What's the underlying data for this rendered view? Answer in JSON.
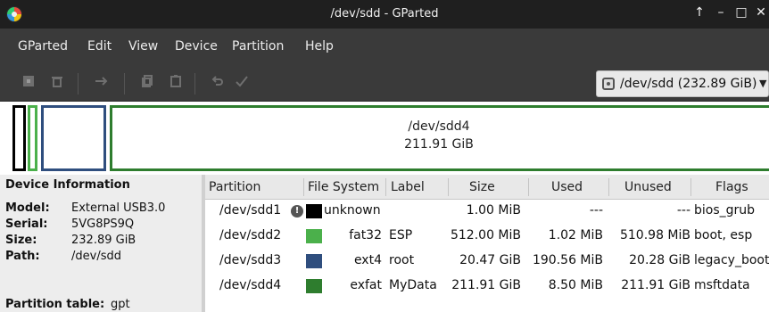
{
  "window": {
    "title": "/dev/sdd - GParted",
    "controls": {
      "up": "↑",
      "minimize": "–",
      "maximize": "□",
      "close": "✕"
    }
  },
  "menu": [
    "GParted",
    "Edit",
    "View",
    "Device",
    "Partition",
    "Help"
  ],
  "toolbar": {
    "icons": [
      "new-icon",
      "delete-icon",
      "resize-move-icon",
      "copy-icon",
      "paste-icon",
      "undo-icon",
      "apply-icon"
    ],
    "device_selector": "/dev/sdd (232.89 GiB)"
  },
  "graphic": {
    "main_partition_name": "/dev/sdd4",
    "main_partition_size": "211.91 GiB"
  },
  "device_info": {
    "heading": "Device Information",
    "model_label": "Model:",
    "model": "External USB3.0",
    "serial_label": "Serial:",
    "serial": "5VG8PS9Q",
    "size_label": "Size:",
    "size": "232.89 GiB",
    "path_label": "Path:",
    "path": "/dev/sdd",
    "partition_table_label": "Partition table:",
    "partition_table": "gpt"
  },
  "table": {
    "columns": [
      "Partition",
      "File System",
      "Label",
      "Size",
      "Used",
      "Unused",
      "Flags"
    ],
    "rows": [
      {
        "partition": "/dev/sdd1",
        "fs": "unknown",
        "fs_color": "#000000",
        "label": "",
        "size": "1.00 MiB",
        "used": "---",
        "unused": "---",
        "flags": "bios_grub"
      },
      {
        "partition": "/dev/sdd2",
        "fs": "fat32",
        "fs_color": "#4bb04b",
        "label": "ESP",
        "size": "512.00 MiB",
        "used": "1.02 MiB",
        "unused": "510.98 MiB",
        "flags": "boot, esp"
      },
      {
        "partition": "/dev/sdd3",
        "fs": "ext4",
        "fs_color": "#2f4e7e",
        "label": "root",
        "size": "20.47 GiB",
        "used": "190.56 MiB",
        "unused": "20.28 GiB",
        "flags": "legacy_boot"
      },
      {
        "partition": "/dev/sdd4",
        "fs": "exfat",
        "fs_color": "#2e7d2e",
        "label": "MyData",
        "size": "211.91 GiB",
        "used": "8.50 MiB",
        "unused": "211.91 GiB",
        "flags": "msftdata"
      }
    ]
  },
  "colors": {
    "unknown": "#000000",
    "fat32": "#4bb04b",
    "ext4": "#2f4e7e",
    "exfat": "#2e7d2e"
  }
}
